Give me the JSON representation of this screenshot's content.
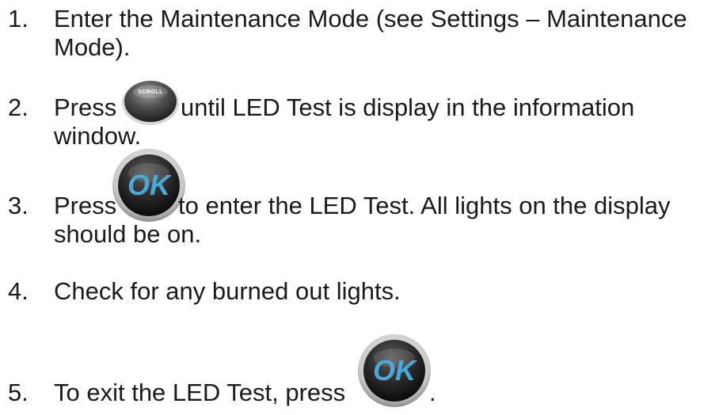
{
  "steps": [
    {
      "number": "1.",
      "line1": "Enter the Maintenance Mode (see Settings – Maintenance",
      "line2": "Mode)."
    },
    {
      "number": "2.",
      "pre": "Press",
      "post": "until LED Test is display in the information",
      "line2": "window.",
      "button_icon": "scroll-button-icon",
      "button_label": "SCROLL"
    },
    {
      "number": "3.",
      "pre": "Press",
      "post": "to enter the LED Test. All lights on the display",
      "line2": "should be on.",
      "button_icon": "ok-button-icon",
      "button_label": "OK"
    },
    {
      "number": "4.",
      "line1": "Check for any burned out lights."
    },
    {
      "number": "5.",
      "pre": "To exit the LED Test, press",
      "post": ".",
      "button_icon": "ok-button-icon",
      "button_label": "OK"
    }
  ],
  "colors": {
    "text": "#1a1a1a",
    "ok_button": "#4aa8d8",
    "scroll_button": "#6a6a6a"
  }
}
